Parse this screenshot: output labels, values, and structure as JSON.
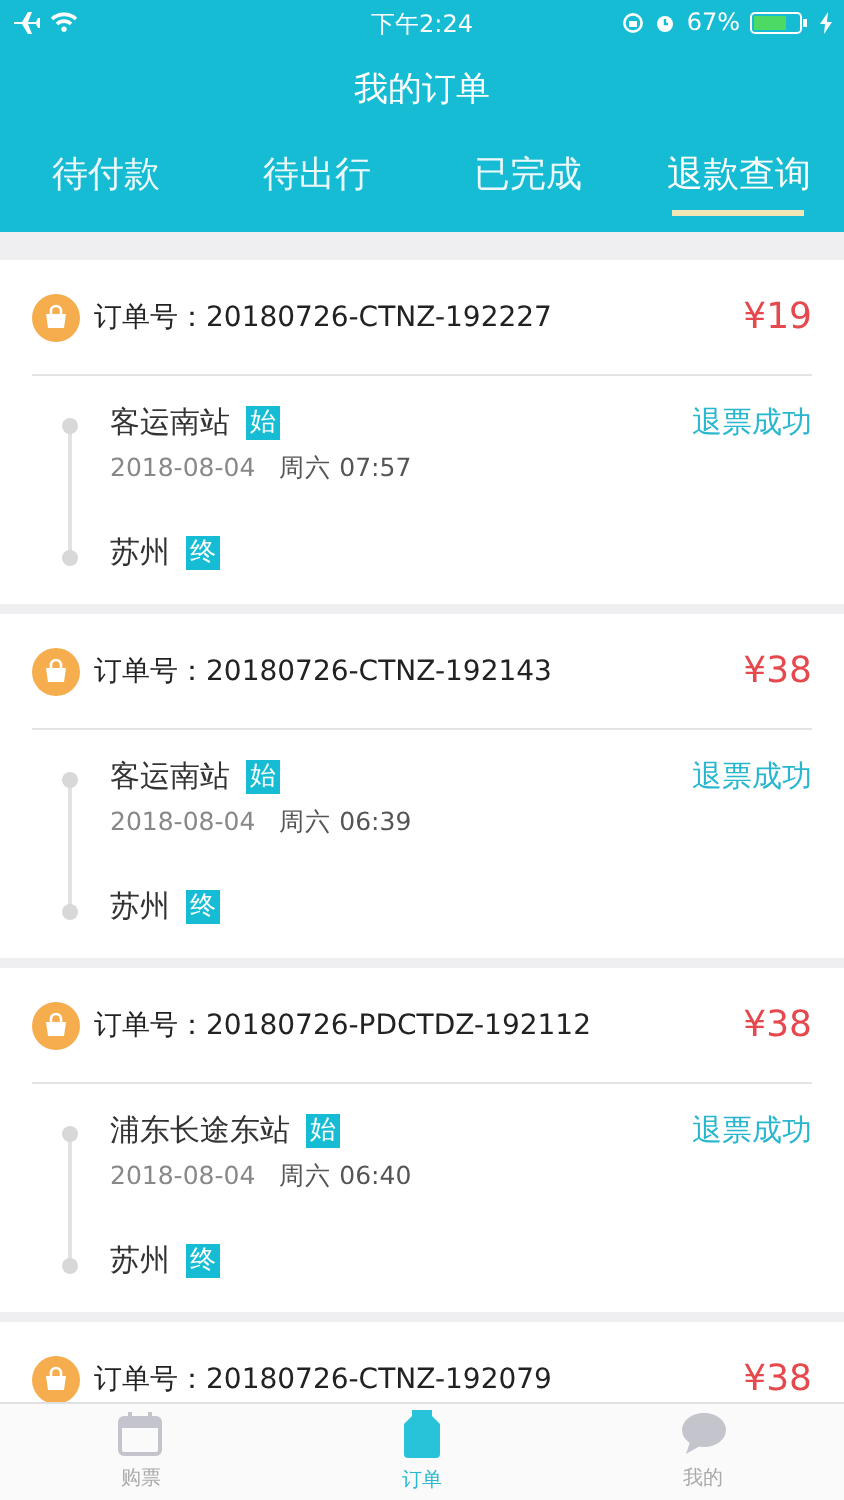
{
  "status_bar": {
    "time": "下午2:24",
    "battery": "67%"
  },
  "header": {
    "title": "我的订单"
  },
  "tabs": [
    {
      "label": "待付款",
      "selected": false
    },
    {
      "label": "待出行",
      "selected": false
    },
    {
      "label": "已完成",
      "selected": false
    },
    {
      "label": "退款查询",
      "selected": true
    }
  ],
  "orders": [
    {
      "order_label": "订单号：",
      "order_no": "20180726-CTNZ-192227",
      "price": "¥19",
      "from": "客运南站",
      "from_tag": "始",
      "date": "2018-08-04",
      "weekday_time": "周六 07:57",
      "status": "退票成功",
      "to": "苏州",
      "to_tag": "终"
    },
    {
      "order_label": "订单号：",
      "order_no": "20180726-CTNZ-192143",
      "price": "¥38",
      "from": "客运南站",
      "from_tag": "始",
      "date": "2018-08-04",
      "weekday_time": "周六 06:39",
      "status": "退票成功",
      "to": "苏州",
      "to_tag": "终"
    },
    {
      "order_label": "订单号：",
      "order_no": "20180726-PDCTDZ-192112",
      "price": "¥38",
      "from": "浦东长途东站",
      "from_tag": "始",
      "date": "2018-08-04",
      "weekday_time": "周六 06:40",
      "status": "退票成功",
      "to": "苏州",
      "to_tag": "终"
    },
    {
      "order_label": "订单号：",
      "order_no": "20180726-CTNZ-192079",
      "price": "¥38"
    }
  ],
  "tab_bar": [
    {
      "label": "购票",
      "kind": "calendar",
      "selected": false
    },
    {
      "label": "订单",
      "kind": "bag",
      "selected": true
    },
    {
      "label": "我的",
      "kind": "chat",
      "selected": false
    }
  ]
}
